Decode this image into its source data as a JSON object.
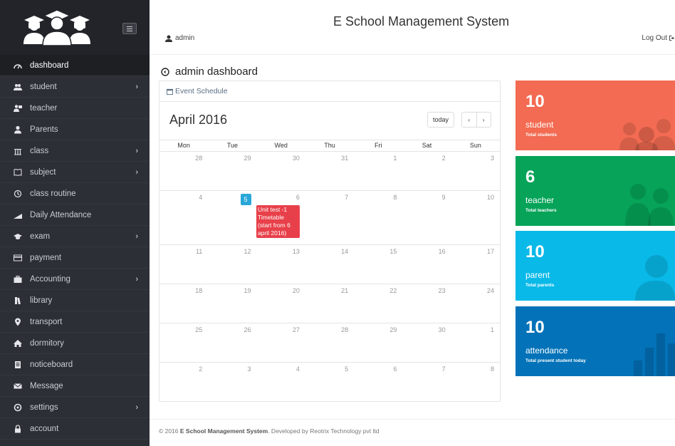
{
  "header": {
    "app_title": "E School Management System",
    "user": "admin",
    "logout_label": "Log Out"
  },
  "sidebar": {
    "items": [
      {
        "label": "dashboard",
        "icon": "dashboard-icon",
        "active": true,
        "submenu": false
      },
      {
        "label": "student",
        "icon": "users-icon",
        "submenu": true
      },
      {
        "label": "teacher",
        "icon": "teacher-icon",
        "submenu": false
      },
      {
        "label": "Parents",
        "icon": "user-icon",
        "submenu": false
      },
      {
        "label": "class",
        "icon": "class-icon",
        "submenu": true
      },
      {
        "label": "subject",
        "icon": "book-icon",
        "submenu": true
      },
      {
        "label": "class routine",
        "icon": "routine-icon",
        "submenu": false
      },
      {
        "label": "Daily Attendance",
        "icon": "chart-icon",
        "submenu": false
      },
      {
        "label": "exam",
        "icon": "graduation-icon",
        "submenu": true
      },
      {
        "label": "payment",
        "icon": "card-icon",
        "submenu": false
      },
      {
        "label": "Accounting",
        "icon": "briefcase-icon",
        "submenu": true
      },
      {
        "label": "library",
        "icon": "library-icon",
        "submenu": false
      },
      {
        "label": "transport",
        "icon": "map-marker-icon",
        "submenu": false
      },
      {
        "label": "dormitory",
        "icon": "home-icon",
        "submenu": false
      },
      {
        "label": "noticeboard",
        "icon": "notice-icon",
        "submenu": false
      },
      {
        "label": "Message",
        "icon": "envelope-icon",
        "submenu": false
      },
      {
        "label": "settings",
        "icon": "gear-icon",
        "submenu": true
      },
      {
        "label": "account",
        "icon": "lock-icon",
        "submenu": false
      }
    ]
  },
  "main": {
    "page_title": "admin dashboard",
    "calendar": {
      "tab_label": "Event Schedule",
      "month_label": "April 2016",
      "today_label": "today",
      "prev_label": "‹",
      "next_label": "›",
      "weekdays": [
        "Mon",
        "Tue",
        "Wed",
        "Thu",
        "Fri",
        "Sat",
        "Sun"
      ],
      "weeks": [
        [
          "28",
          "29",
          "30",
          "31",
          "1",
          "2",
          "3"
        ],
        [
          "4",
          "5",
          "6",
          "7",
          "8",
          "9",
          "10"
        ],
        [
          "11",
          "12",
          "13",
          "14",
          "15",
          "16",
          "17"
        ],
        [
          "18",
          "19",
          "20",
          "21",
          "22",
          "23",
          "24"
        ],
        [
          "25",
          "26",
          "27",
          "28",
          "29",
          "30",
          "1"
        ],
        [
          "2",
          "3",
          "4",
          "5",
          "6",
          "7",
          "8"
        ]
      ],
      "today_day": "5",
      "event": {
        "title": "Unit test -1 Timetable (start from 6 april 2016)",
        "color": "#e8404a"
      }
    },
    "cards": [
      {
        "value": "10",
        "label": "student",
        "sub": "Total students",
        "color": "#f26b52",
        "icon": "users-icon"
      },
      {
        "value": "6",
        "label": "teacher",
        "sub": "Total teachers",
        "color": "#06a358",
        "icon": "teacher-icon"
      },
      {
        "value": "10",
        "label": "parent",
        "sub": "Total parents",
        "color": "#09b9e8",
        "icon": "user-icon"
      },
      {
        "value": "10",
        "label": "attendance",
        "sub": "Total present student today",
        "color": "#0372b8",
        "icon": "bar-chart-icon"
      }
    ]
  },
  "footer": {
    "prefix": "© 2016 ",
    "app_name": "E School Management System",
    "middle": ". Developed by ",
    "company": "Reotrix Technology pvt ltd"
  }
}
